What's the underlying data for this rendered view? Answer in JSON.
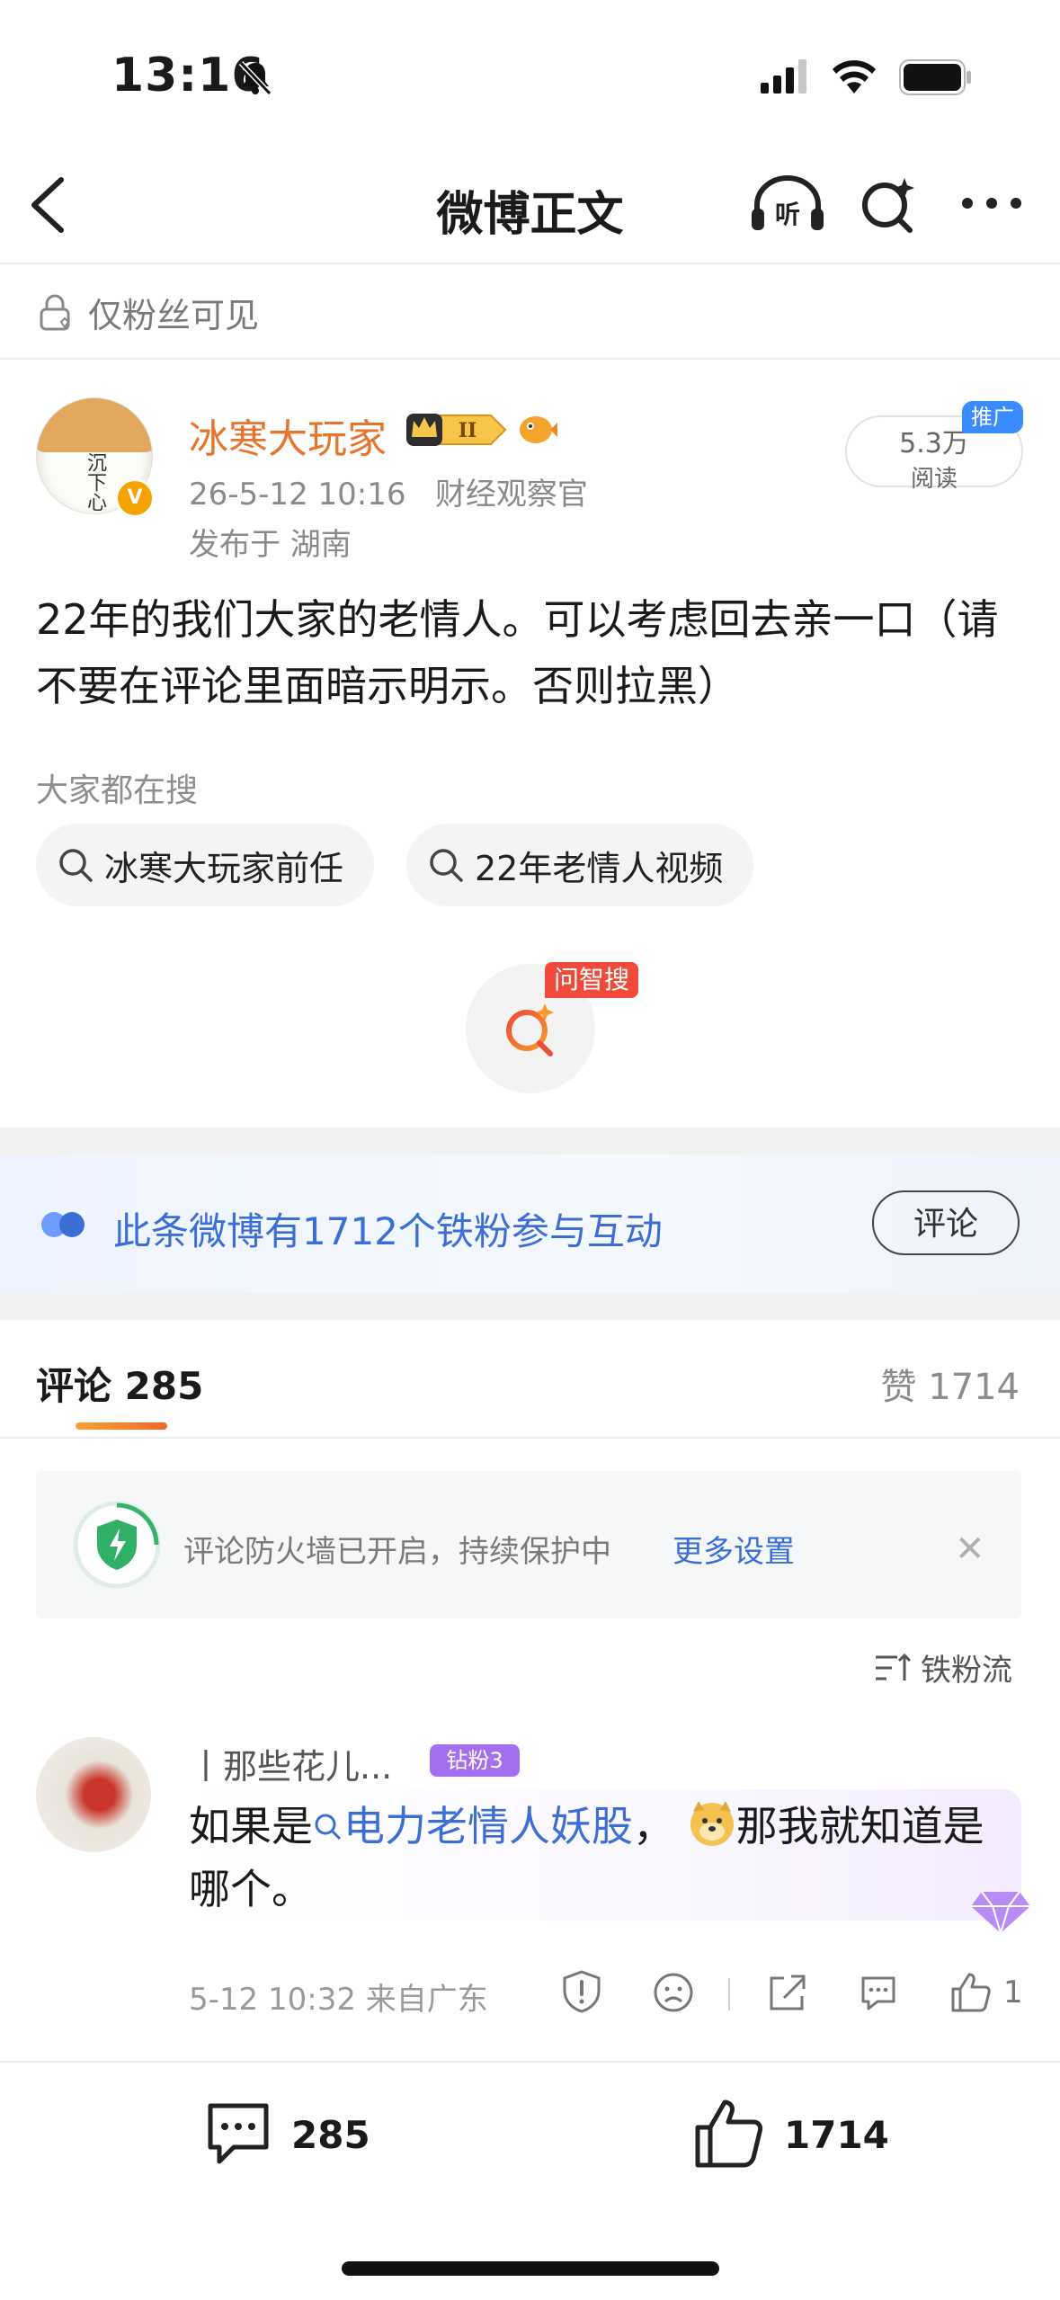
{
  "status_bar": {
    "time": "13:16"
  },
  "nav": {
    "title": "微博正文"
  },
  "visibility": {
    "label": "仅粉丝可见"
  },
  "author": {
    "avatar_text": "沉下心",
    "name": "冰寒大玩家",
    "crown_level": "II",
    "date": "26-5-12 10:16",
    "source": "财经观察官",
    "location": "发布于 湖南",
    "reads_count": "5.3万",
    "reads_label": "阅读",
    "promo_tag": "推广"
  },
  "post": {
    "body": "22年的我们大家的老情人。可以考虑回去亲一口（请不要在评论里面暗示明示。否则拉黑）"
  },
  "hot_search": {
    "title": "大家都在搜",
    "chips": [
      "冰寒大玩家前任",
      "22年老情人视频"
    ]
  },
  "ai_search": {
    "tag": "问智搜"
  },
  "fans_banner": {
    "text": "此条微博有1712个铁粉参与互动",
    "button": "评论"
  },
  "tabs": {
    "comments_label": "评论 285",
    "likes_label": "赞 1714"
  },
  "firewall": {
    "text": "评论防火墙已开启，持续保护中",
    "link": "更多设置",
    "close": "✕"
  },
  "sort": {
    "label": "铁粉流"
  },
  "comment": {
    "username": "丨那些花儿...",
    "fan_badge": "钻粉3",
    "text_before": "如果是",
    "link_text": "电力老情人妖股",
    "text_after": "，",
    "text_end": "那我就知道是哪个。",
    "time_location": "5-12 10:32  来自广东",
    "like_count": "1"
  },
  "bottom_bar": {
    "comments_count": "285",
    "likes_count": "1714"
  },
  "colors": {
    "accent_orange": "#e8742c",
    "link_blue": "#3b6fd6",
    "fan_purple": "#a36ef0",
    "promo_blue": "#3a8bff",
    "ai_red": "#ef4a3a"
  }
}
